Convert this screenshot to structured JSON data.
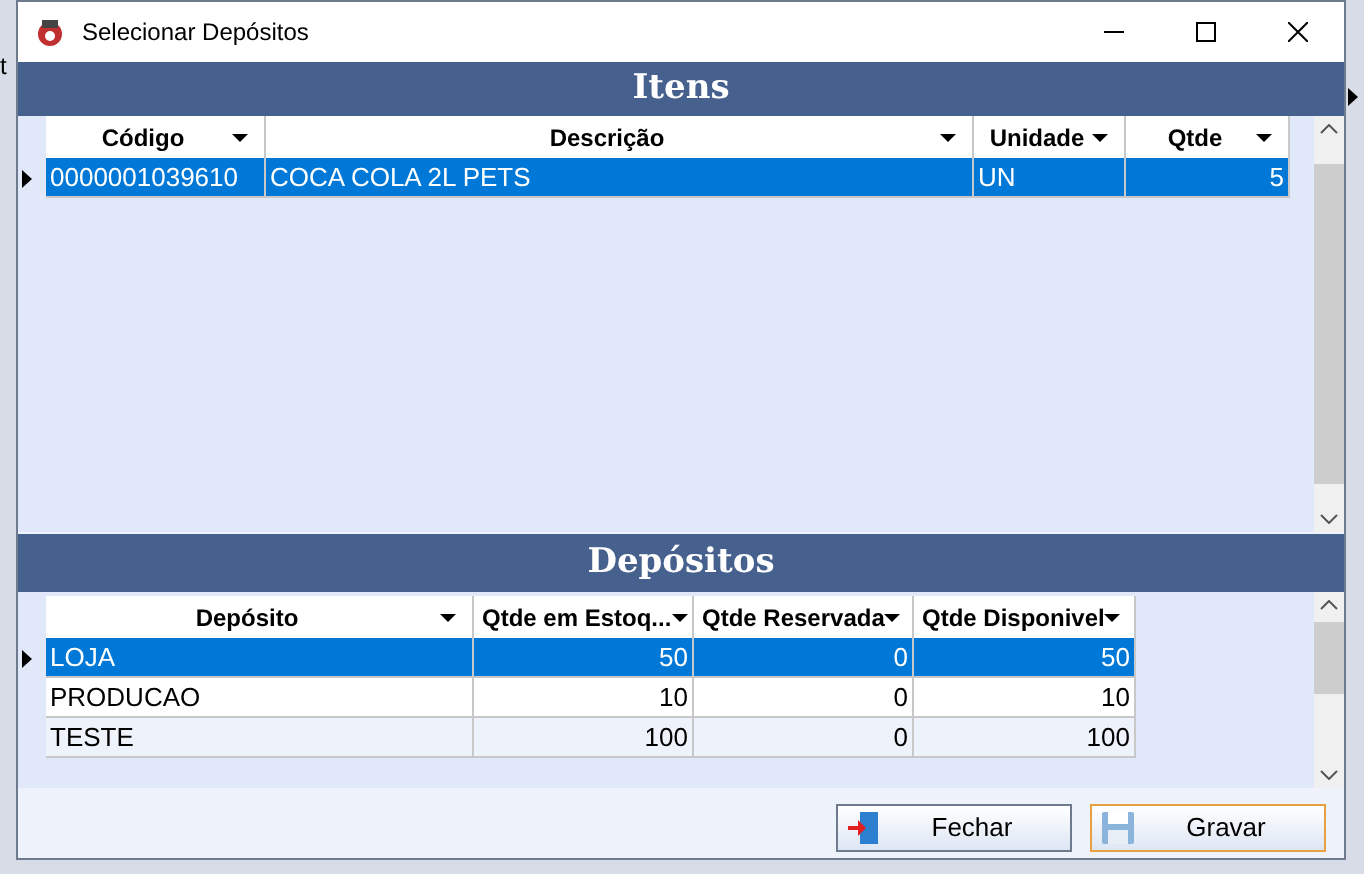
{
  "background_text": "t",
  "window": {
    "title": "Selecionar Depósitos"
  },
  "items": {
    "title": "Itens",
    "columns": [
      {
        "label": "Código",
        "kind": "text"
      },
      {
        "label": "Descrição",
        "kind": "text"
      },
      {
        "label": "Unidade",
        "kind": "text"
      },
      {
        "label": "Qtde",
        "kind": "number"
      }
    ],
    "rows": [
      {
        "selected": true,
        "cells": [
          "0000001039610",
          "COCA COLA 2L PETS",
          "UN",
          "5"
        ]
      }
    ]
  },
  "deposits": {
    "title": "Depósitos",
    "columns": [
      {
        "label": "Depósito",
        "kind": "text"
      },
      {
        "label": "Qtde em Estoq...",
        "kind": "number"
      },
      {
        "label": "Qtde Reservada",
        "kind": "number"
      },
      {
        "label": "Qtde Disponivel",
        "kind": "number"
      }
    ],
    "rows": [
      {
        "selected": true,
        "cells": [
          "LOJA",
          "50",
          "0",
          "50"
        ]
      },
      {
        "selected": false,
        "cells": [
          "PRODUCAO",
          "10",
          "0",
          "10"
        ]
      },
      {
        "selected": false,
        "cells": [
          "TESTE",
          "100",
          "0",
          "100"
        ]
      }
    ]
  },
  "buttons": [
    {
      "label": "Fechar",
      "kind": "close",
      "focused": false
    },
    {
      "label": "Gravar",
      "kind": "save",
      "focused": true
    }
  ]
}
